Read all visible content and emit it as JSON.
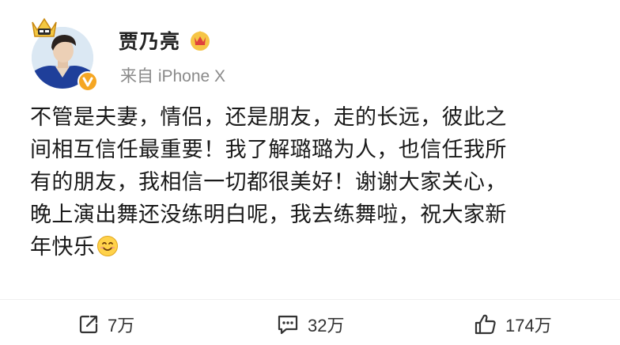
{
  "post": {
    "author": "贾乃亮",
    "source": "来自 iPhone X",
    "content_lines": [
      "不管是夫妻，情侣，还是朋友，走的长远，彼此之",
      "间相互信任最重要！我了解璐璐为人，也信任我所",
      "有的朋友，我相信一切都很美好！谢谢大家关心，",
      "晚上演出舞还没练明白呢，我去练舞啦，祝大家新",
      "年快乐"
    ]
  },
  "actions": {
    "repost_count": "7万",
    "comment_count": "32万",
    "like_count": "174万"
  },
  "icons": {
    "crown": "crown-icon",
    "verified": "verified-v-icon",
    "member": "member-crown-icon",
    "smile": "smile-emoji",
    "repost": "repost-icon",
    "comment": "comment-icon",
    "like": "thumbs-up-icon"
  },
  "colors": {
    "verified": "#f5a623",
    "text": "#1a1a1a",
    "muted": "#8a8a8a"
  }
}
